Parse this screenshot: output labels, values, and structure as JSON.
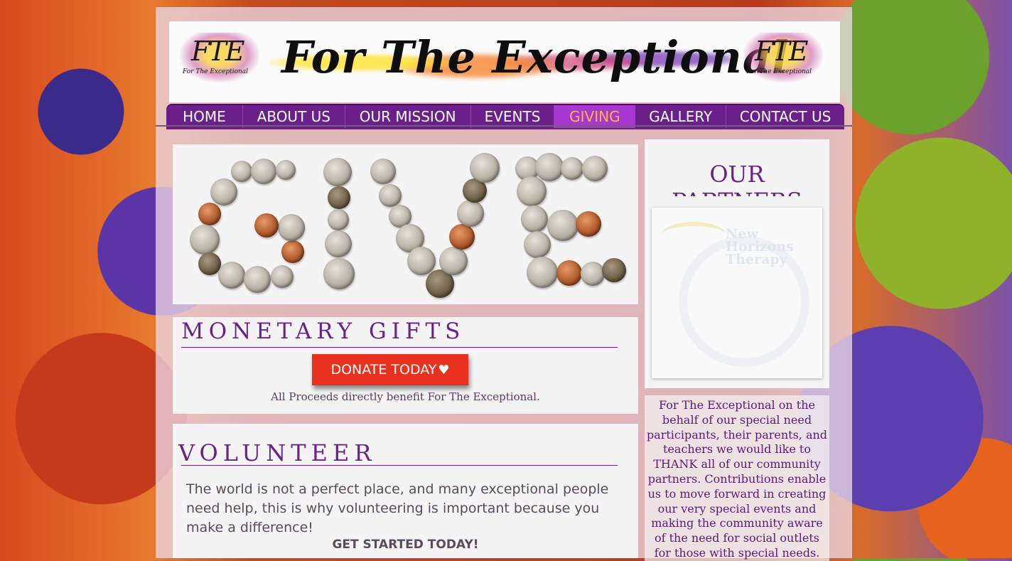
{
  "header": {
    "title": "For The Exceptional",
    "logo_mark": "FTE",
    "logo_sub": "For The Exceptional"
  },
  "nav": {
    "items": [
      "HOME",
      "ABOUT US",
      "OUR MISSION",
      "EVENTS",
      "GIVING",
      "GALLERY",
      "CONTACT US"
    ],
    "active": "GIVING"
  },
  "giving": {
    "image_word": "GIVE",
    "monetary_title": "MONETARY GIFTS",
    "donate_label": "DONATE TODAY",
    "donate_icon": "heart-hands-icon",
    "proceeds_text": "All Proceeds directly benefit For The Exceptional."
  },
  "volunteer": {
    "title": "VOLUNTEER",
    "body": "The world is not a perfect place, and many exceptional people need help,  this is why volunteering is important because you make a difference!",
    "cta": "GET STARTED TODAY!"
  },
  "partners": {
    "title": "OUR PARTNERS",
    "logo_name": "New Horizons Therapy",
    "text": "For The Exceptional on the behalf of our special need participants, their parents, and teachers we would like to THANK all of our community partners. Contributions enable us to move forward in creating our very special events and making the community aware of the need for social outlets for those with special needs."
  },
  "colors": {
    "brand_purple": "#6b1f8a",
    "nav_active_bg": "#a836d0",
    "nav_active_text": "#ffb246",
    "donate_red": "#e8311f"
  }
}
